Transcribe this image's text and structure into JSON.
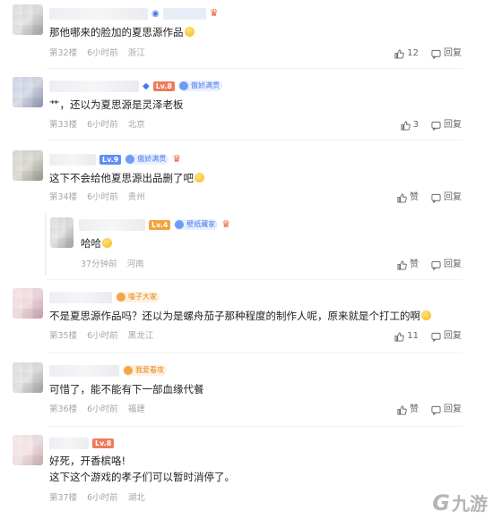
{
  "comments": [
    {
      "text": "那他哪来的脸加的夏思源作品",
      "floor": "第32楼",
      "time": "6小时前",
      "location": "浙江",
      "likes": "12",
      "reply": "回复"
    },
    {
      "level": "Lv.8",
      "tag": "傲娇满贯",
      "text": "艹，还以为夏思源是灵泽老板",
      "floor": "第33楼",
      "time": "6小时前",
      "location": "北京",
      "likes": "3",
      "reply": "回复"
    },
    {
      "level": "Lv.9",
      "tag": "傲娇满贯",
      "text": "这下不会给他夏思源出品删了吧",
      "floor": "第34楼",
      "time": "6小时前",
      "location": "贵州",
      "likes": "赞",
      "reply": "回复"
    },
    {
      "level": "Lv.4",
      "tag": "壁纸藏家",
      "text": "哈哈",
      "floor": "",
      "time": "37分钟前",
      "location": "河南",
      "likes": "赞",
      "reply": "回复"
    },
    {
      "tag": "嗑子大家",
      "text": "不是夏思源作品吗？还以为是螺舟茄子那种程度的制作人呢，原来就是个打工的啊",
      "floor": "第35楼",
      "time": "6小时前",
      "location": "黑龙江",
      "likes": "11",
      "reply": "回复"
    },
    {
      "tag": "我爱看攻",
      "text": "可惜了，能不能有下一部血缘代餐",
      "floor": "第36楼",
      "time": "6小时前",
      "location": "福建",
      "likes": "赞",
      "reply": "回复"
    },
    {
      "level": "Lv.8",
      "text": "好死，开香槟咯!",
      "text2": "这下这个游戏的孝子们可以暂时消停了。",
      "floor": "第37楼",
      "time": "6小时前",
      "location": "湖北"
    }
  ],
  "watermark": {
    "logo": "G",
    "text": "九游"
  },
  "colors": {
    "accent": "#5b8ef7",
    "meta": "#a3a7ae",
    "level_red": "#f07a5c"
  }
}
